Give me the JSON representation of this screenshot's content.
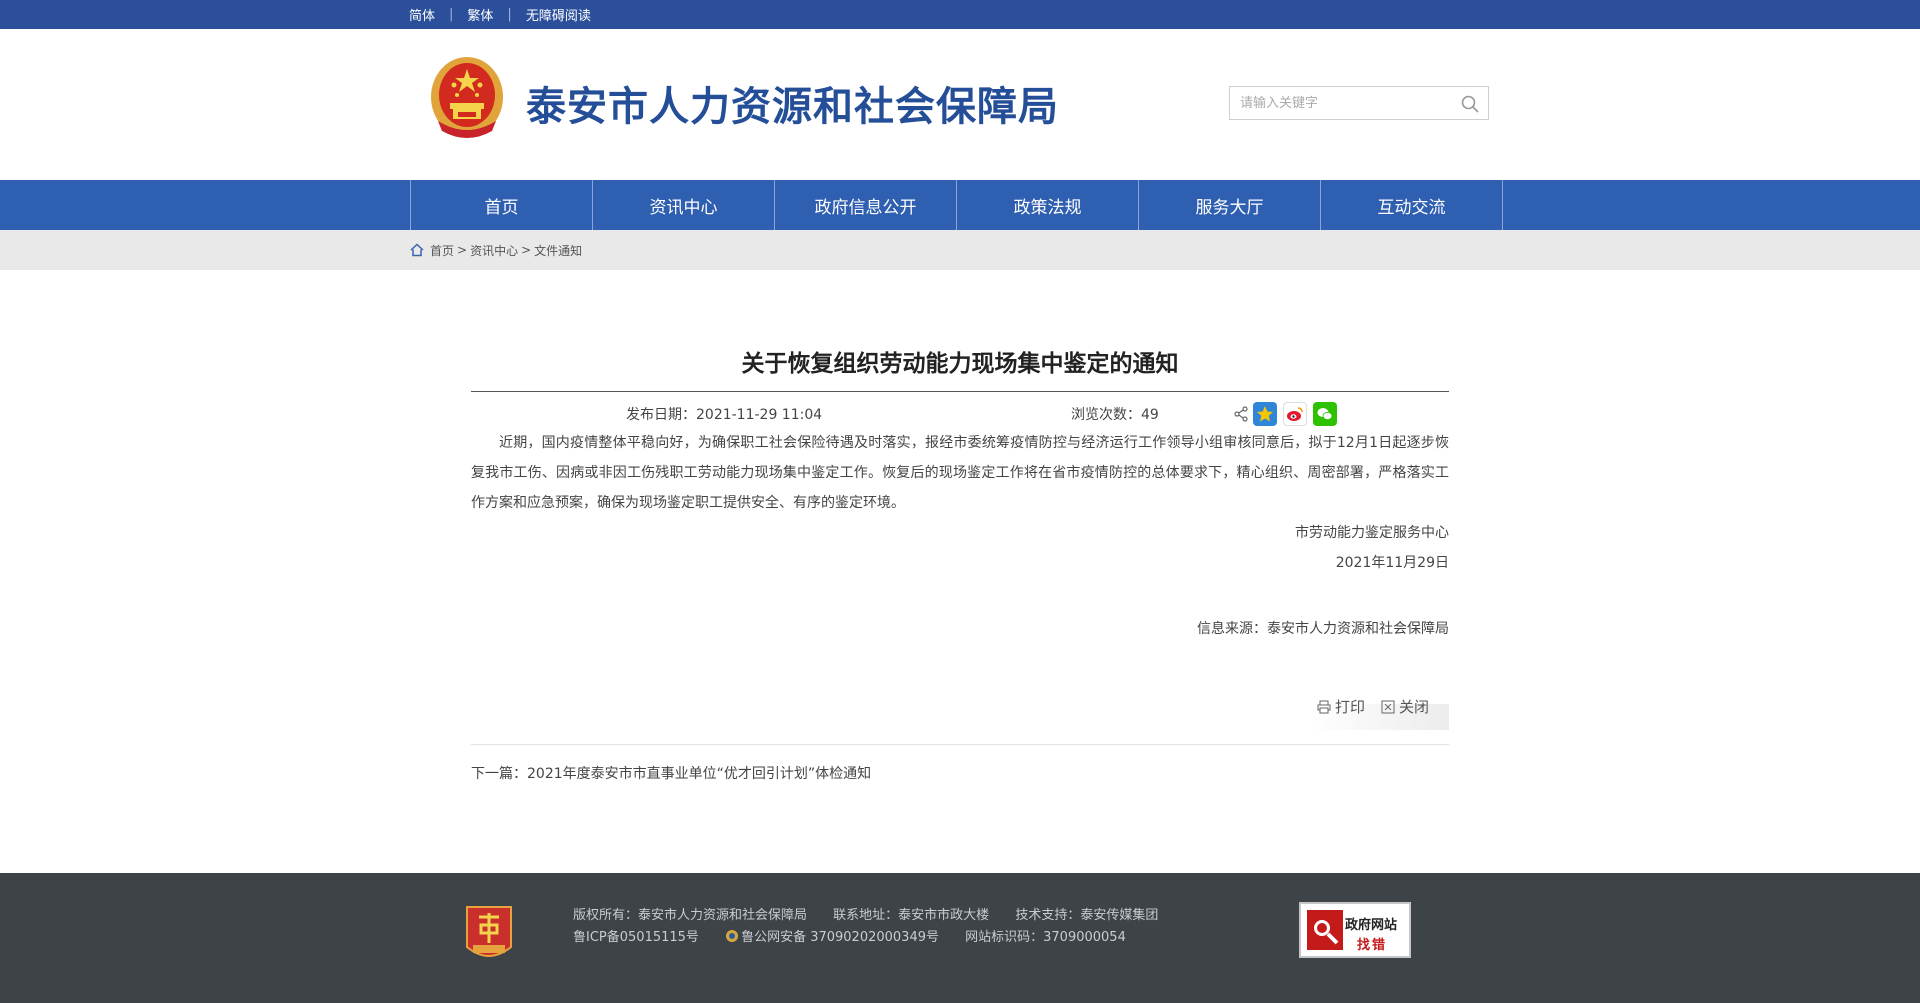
{
  "topbar": {
    "links": [
      "简体",
      "繁体",
      "无障碍阅读"
    ]
  },
  "header": {
    "site_title": "泰安市人力资源和社会保障局",
    "search_placeholder": "请输入关键字"
  },
  "nav": {
    "items": [
      "首页",
      "资讯中心",
      "政府信息公开",
      "政策法规",
      "服务大厅",
      "互动交流"
    ]
  },
  "breadcrumb": {
    "items": [
      "首页",
      "资讯中心",
      "文件通知"
    ],
    "separator": ">"
  },
  "article": {
    "title": "关于恢复组织劳动能力现场集中鉴定的通知",
    "publish_date": "发布日期：2021-11-29 11:04",
    "views": "浏览次数：49",
    "body": "近期，国内疫情整体平稳向好，为确保职工社会保险待遇及时落实，报经市委统筹疫情防控与经济运行工作领导小组审核同意后，拟于12月1日起逐步恢复我市工伤、因病或非因工伤残职工劳动能力现场集中鉴定工作。恢复后的现场鉴定工作将在省市疫情防控的总体要求下，精心组织、周密部署，严格落实工作方案和应急预案，确保为现场鉴定职工提供安全、有序的鉴定环境。",
    "signature_org": "市劳动能力鉴定服务中心",
    "signature_date": "2021年11月29日",
    "source": "信息来源：泰安市人力资源和社会保障局",
    "print_label": "打印",
    "close_label": "关闭",
    "next_article": "下一篇：2021年度泰安市市直事业单位“优才回引计划”体检通知"
  },
  "footer": {
    "copyright": "版权所有：泰安市人力资源和社会保障局",
    "address": "联系地址：泰安市市政大楼",
    "support": "技术支持：泰安传媒集团",
    "icp": "鲁ICP备05015115号",
    "police": "鲁公网安备 37090202000349号",
    "site_code": "网站标识码：3709000054",
    "findbug_line1": "政府网站",
    "findbug_line2": "找错"
  },
  "colors": {
    "topbar": "#2b4f9a",
    "nav": "#2f5fb0",
    "title": "#244e98",
    "footer": "#3e4348"
  }
}
